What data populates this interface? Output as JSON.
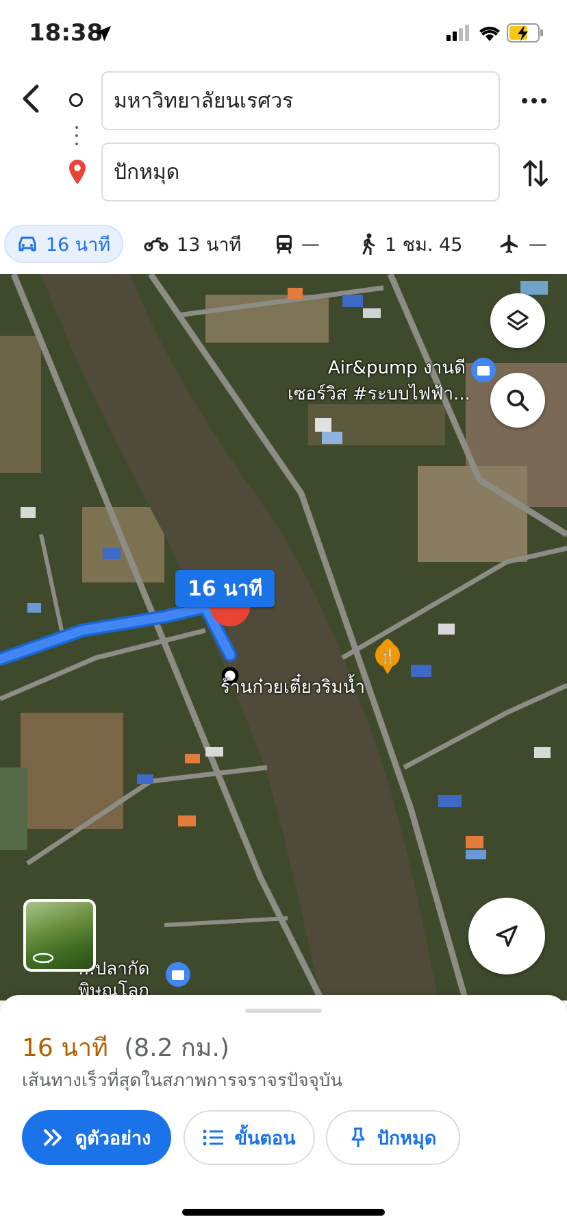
{
  "status_bar": {
    "time": "18:38"
  },
  "route": {
    "origin": "มหาวิทยาลัยนเรศวร",
    "destination": "ปักหมุด"
  },
  "modes": [
    {
      "icon": "car-icon",
      "label": "16 นาที",
      "active": true
    },
    {
      "icon": "motorbike-icon",
      "label": "13 นาที"
    },
    {
      "icon": "transit-icon",
      "label": "—"
    },
    {
      "icon": "walk-icon",
      "label": "1 ชม. 45"
    },
    {
      "icon": "flight-icon",
      "label": "—"
    }
  ],
  "map": {
    "route_label": "16 นาที",
    "pois": {
      "shop_line1": "Air&pump งานดี",
      "shop_line2": "เซอร์วิส #ระบบไฟฟ้า...",
      "restaurant": "ร้านก๋วยเตี๋ยวริมน้ำ",
      "bottom_line1": "...ปลากัด",
      "bottom_line2": "พิษณุโลก"
    },
    "colors": {
      "route": "#4285f4",
      "pin": "#ea4335",
      "restaurant_marker": "#f29900",
      "shop_marker": "#4285f4"
    }
  },
  "sheet": {
    "duration": "16 นาที",
    "distance": "(8.2 กม.)",
    "subtitle": "เส้นทางเร็วที่สุดในสภาพการจราจรปัจจุบัน",
    "buttons": {
      "preview": "ดูตัวอย่าง",
      "steps": "ขั้นตอน",
      "pin": "ปักหมุด"
    }
  },
  "colors": {
    "accent": "#1a73e8",
    "duration": "#b06000"
  }
}
